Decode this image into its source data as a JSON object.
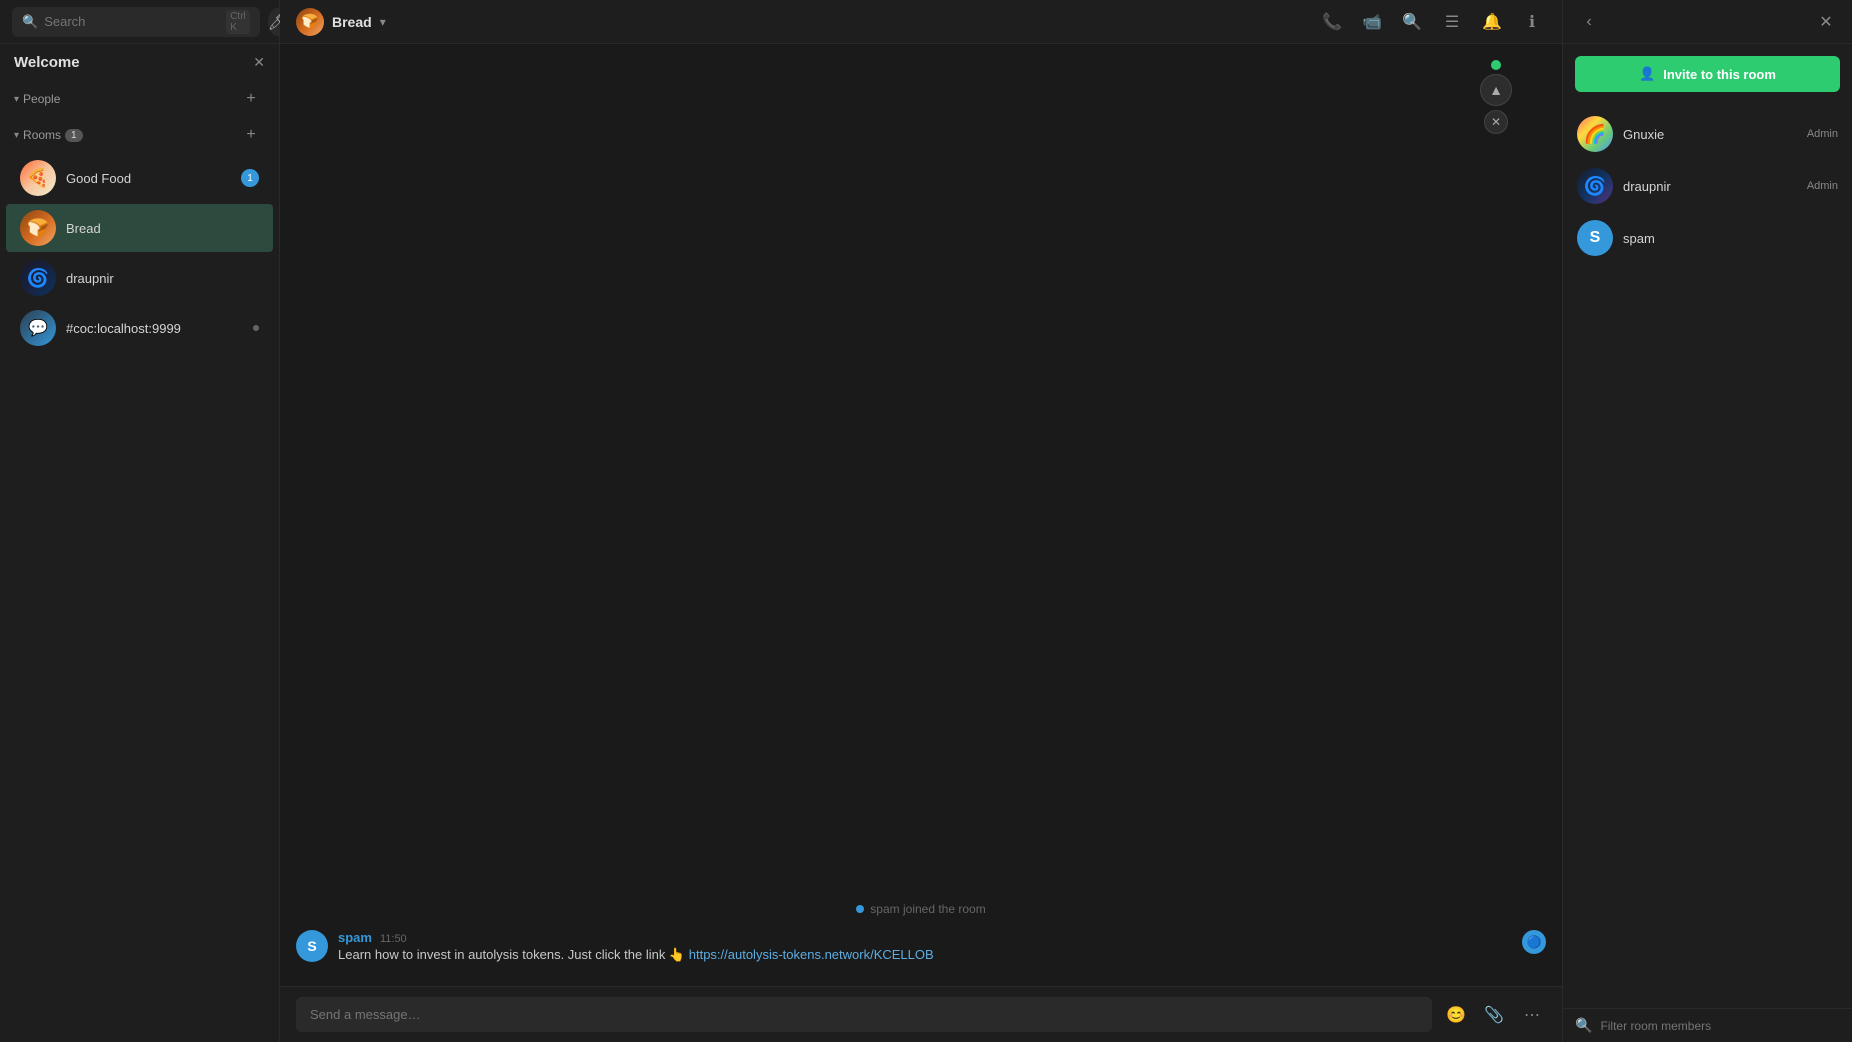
{
  "sidebar": {
    "search": {
      "placeholder": "Search",
      "shortcut": "Ctrl K"
    },
    "welcome_title": "Welcome",
    "sections": {
      "people": {
        "label": "People",
        "collapsed": false
      },
      "rooms": {
        "label": "Rooms",
        "collapsed": false,
        "unread_count": "1"
      }
    },
    "rooms": [
      {
        "name": "Good Food",
        "avatar_emoji": "🍕",
        "unread": "1",
        "type": "good-food"
      },
      {
        "name": "Bread",
        "avatar_emoji": "🍞",
        "unread": null,
        "type": "bread",
        "active": true
      },
      {
        "name": "draupnir",
        "avatar_emoji": "🌀",
        "unread": null,
        "type": "draupnir"
      },
      {
        "name": "#coc:localhost:9999",
        "avatar_emoji": "💬",
        "unread": null,
        "type": "coc",
        "dot": true
      }
    ]
  },
  "chat": {
    "room_name": "Bread",
    "room_avatar_emoji": "🍞",
    "chevron": "▾",
    "system_messages": [
      {
        "text": "spam joined the room",
        "dot": true
      }
    ],
    "messages": [
      {
        "sender": "spam",
        "time": "11:50",
        "avatar_letter": "S",
        "text_before_link": "Learn how to invest in autolysis tokens. Just click the link 👆 ",
        "link_text": "https://autolysis-tokens.network/KCELLOB",
        "link_href": "https://autolysis-tokens.network/KCELLOB"
      }
    ],
    "input_placeholder": "Send a message…"
  },
  "header_icons": {
    "phone": "📞",
    "video": "📹",
    "search": "🔍",
    "layout": "☰",
    "bell": "🔔",
    "info": "ℹ"
  },
  "right_panel": {
    "invite_btn_label": "Invite to this room",
    "members": [
      {
        "name": "Gnuxie",
        "role": "Admin",
        "avatar_type": "gnuxie"
      },
      {
        "name": "draupnir",
        "role": "Admin",
        "avatar_type": "draupnir"
      },
      {
        "name": "spam",
        "role": "",
        "avatar_letter": "S",
        "avatar_type": "spam"
      }
    ],
    "filter_placeholder": "Filter room members"
  }
}
